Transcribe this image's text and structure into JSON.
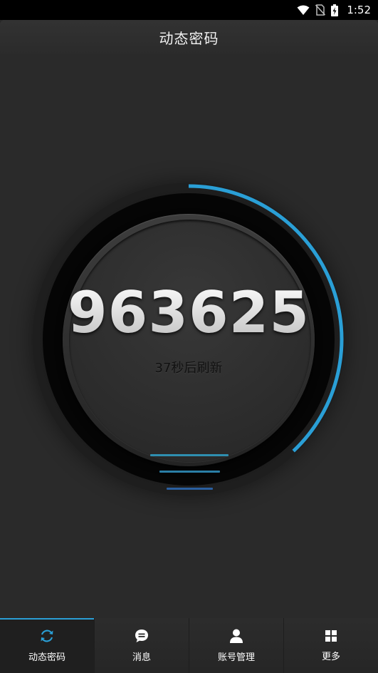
{
  "status_bar": {
    "time": "1:52"
  },
  "header": {
    "title": "动态密码"
  },
  "token": {
    "code": "963625",
    "refresh_text": "37秒后刷新",
    "remaining_seconds": 37,
    "period_seconds": 60,
    "progress_fraction": 0.38
  },
  "colors": {
    "accent": "#2a9fd6",
    "background": "#2a2a2a"
  },
  "nav": {
    "items": [
      {
        "label": "动态密码",
        "icon": "refresh-icon",
        "active": true
      },
      {
        "label": "消息",
        "icon": "message-icon",
        "active": false
      },
      {
        "label": "账号管理",
        "icon": "person-icon",
        "active": false
      },
      {
        "label": "更多",
        "icon": "grid-icon",
        "active": false
      }
    ]
  }
}
